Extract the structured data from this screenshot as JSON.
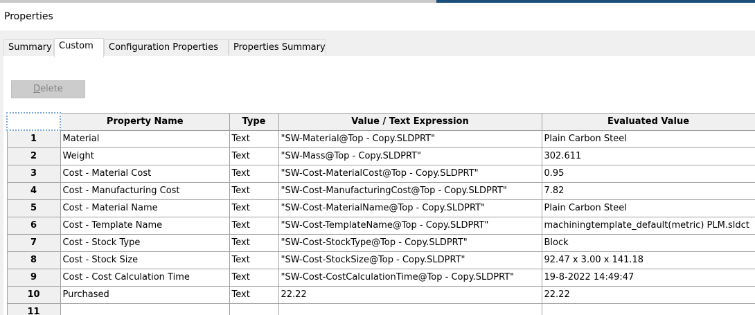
{
  "window": {
    "title": "Properties"
  },
  "tabs": [
    {
      "label": "Summary",
      "active": false
    },
    {
      "label": "Custom",
      "active": true
    },
    {
      "label": "Configuration Properties",
      "active": false
    },
    {
      "label": "Properties Summary",
      "active": false
    }
  ],
  "toolbar": {
    "delete_label_mnemonic": "D",
    "delete_label_rest": "elete",
    "delete_enabled": false
  },
  "grid": {
    "columns": [
      "",
      "Property Name",
      "Type",
      "Value / Text Expression",
      "Evaluated Value"
    ],
    "rows": [
      {
        "num": "1",
        "name": "Material",
        "type": "Text",
        "expression": "\"SW-Material@Top - Copy.SLDPRT\"",
        "value": "Plain Carbon Steel"
      },
      {
        "num": "2",
        "name": "Weight",
        "type": "Text",
        "expression": "\"SW-Mass@Top - Copy.SLDPRT\"",
        "value": "302.611"
      },
      {
        "num": "3",
        "name": "Cost - Material Cost",
        "type": "Text",
        "expression": "\"SW-Cost-MaterialCost@Top - Copy.SLDPRT\"",
        "value": "0.95"
      },
      {
        "num": "4",
        "name": "Cost - Manufacturing Cost",
        "type": "Text",
        "expression": "\"SW-Cost-ManufacturingCost@Top - Copy.SLDPRT\"",
        "value": "7.82"
      },
      {
        "num": "5",
        "name": "Cost - Material Name",
        "type": "Text",
        "expression": "\"SW-Cost-MaterialName@Top - Copy.SLDPRT\"",
        "value": "Plain Carbon Steel"
      },
      {
        "num": "6",
        "name": "Cost - Template Name",
        "type": "Text",
        "expression": "\"SW-Cost-TemplateName@Top - Copy.SLDPRT\"",
        "value": "machiningtemplate_default(metric) PLM.sldct"
      },
      {
        "num": "7",
        "name": "Cost - Stock Type",
        "type": "Text",
        "expression": "\"SW-Cost-StockType@Top - Copy.SLDPRT\"",
        "value": "Block"
      },
      {
        "num": "8",
        "name": "Cost - Stock Size",
        "type": "Text",
        "expression": "\"SW-Cost-StockSize@Top - Copy.SLDPRT\"",
        "value": "92.47 x 3.00 x 141.18"
      },
      {
        "num": "9",
        "name": "Cost - Cost Calculation Time",
        "type": "Text",
        "expression": "\"SW-Cost-CostCalculationTime@Top - Copy.SLDPRT\"",
        "value": "19-8-2022 14:49:47"
      },
      {
        "num": "10",
        "name": "Purchased",
        "type": "Text",
        "expression": "22.22",
        "value": "22.22"
      },
      {
        "num": "11",
        "name": "",
        "type": "",
        "expression": "",
        "value": ""
      }
    ]
  },
  "colors": {
    "accent_dark": "#1c4e7b",
    "dialog_bg": "#f0f0f0",
    "grid_line": "#a0a0a0"
  }
}
